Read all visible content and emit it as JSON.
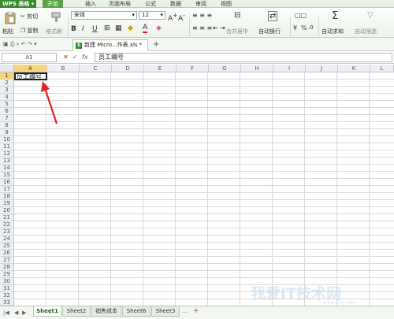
{
  "app": {
    "logo": "WPS 表格"
  },
  "menu": [
    "开始",
    "插入",
    "页面布局",
    "公式",
    "数据",
    "审阅",
    "视图"
  ],
  "ribbon": {
    "paste": "粘贴",
    "cut": "剪切",
    "copy": "复制",
    "format_painter": "格式刷",
    "font_name": "宋体",
    "font_size": "12",
    "merge_center": "合并居中",
    "wrap_text": "自动换行",
    "currency": "¥",
    "percent": "%",
    "autosum": "自动求和",
    "auto_filter": "自动筛选"
  },
  "tabs": {
    "doc_title": "新建 Micro...作表.xls *",
    "add": "+"
  },
  "formula_bar": {
    "name_box": "A1",
    "cancel": "✕",
    "confirm": "✓",
    "fx": "fx",
    "content": "员工编号"
  },
  "columns": [
    "A",
    "B",
    "C",
    "D",
    "E",
    "F",
    "G",
    "H",
    "I",
    "J",
    "K",
    "L"
  ],
  "rows": [
    "1",
    "2",
    "3",
    "4",
    "5",
    "6",
    "7",
    "8",
    "9",
    "10",
    "11",
    "12",
    "13",
    "14",
    "15",
    "16",
    "17",
    "18",
    "19",
    "20",
    "21",
    "22",
    "23",
    "24",
    "25",
    "26",
    "27",
    "28",
    "29",
    "30",
    "31",
    "32",
    "33"
  ],
  "cell_a1": "员工编号",
  "sheets": [
    "Sheet1",
    "Sheet2",
    "销售成本",
    "Sheet6",
    "Sheet3"
  ],
  "sheet_more": "···",
  "sheet_add": "+",
  "watermark": {
    "main": "我爱IT技术网",
    "sub": "www.52ij.com"
  },
  "colors": {
    "accent": "#3b8a2f",
    "selection_header": "#f7d37a",
    "arrow": "#e0231c"
  }
}
